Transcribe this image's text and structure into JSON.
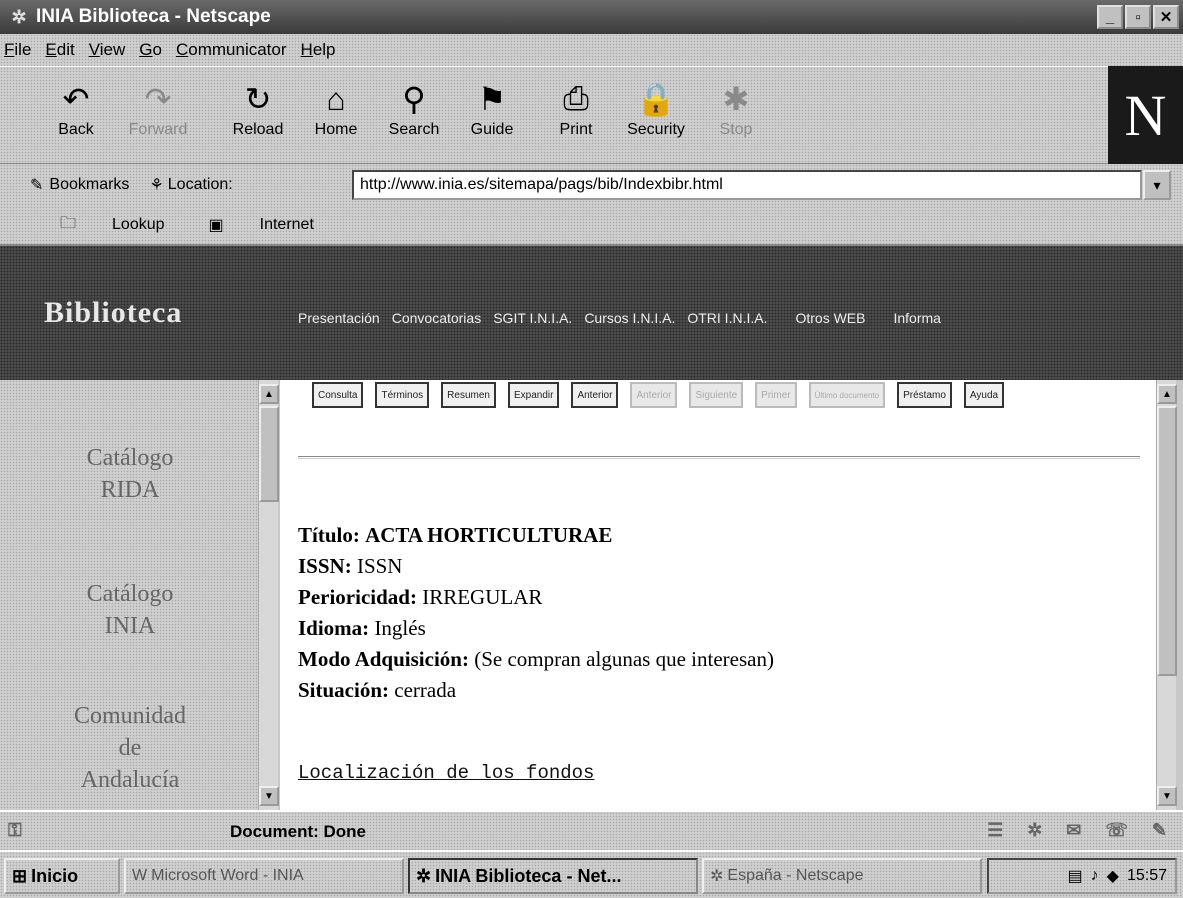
{
  "window": {
    "title": "INIA Biblioteca - Netscape",
    "minimize": "_",
    "maximize": "▫",
    "close": "✕"
  },
  "menu": [
    "File",
    "Edit",
    "View",
    "Go",
    "Communicator",
    "Help"
  ],
  "toolbar": {
    "back": "Back",
    "forward": "Forward",
    "reload": "Reload",
    "home": "Home",
    "search": "Search",
    "guide": "Guide",
    "print": "Print",
    "security": "Security",
    "stop": "Stop",
    "logo": "N"
  },
  "location": {
    "bookmarks": "Bookmarks",
    "label": "Location:",
    "url": "http://www.inia.es/sitemapa/pags/bib/Indexbibr.html"
  },
  "personal": {
    "lookup": "Lookup",
    "internet": "Internet"
  },
  "banner": {
    "title": "Biblioteca",
    "nav": [
      "Presentación",
      "Convocatorias",
      "SGIT I.N.I.A.",
      "Cursos I.N.I.A.",
      "OTRI I.N.I.A.",
      "Otros WEB",
      "Informa"
    ]
  },
  "left": {
    "items": [
      {
        "line1": "Catálogo",
        "line2": "RIDA"
      },
      {
        "line1": "Catálogo",
        "line2": "INIA"
      },
      {
        "line1": "Comunidad",
        "line2": "de",
        "line3": "Andalucía"
      }
    ]
  },
  "buttons": [
    {
      "label": "Consulta",
      "enabled": true
    },
    {
      "label": "Términos",
      "enabled": true
    },
    {
      "label": "Resumen",
      "enabled": true
    },
    {
      "label": "Expandir",
      "enabled": true
    },
    {
      "label": "Anterior",
      "enabled": true
    },
    {
      "label": "Anterior",
      "enabled": false
    },
    {
      "label": "Siguiente",
      "enabled": false
    },
    {
      "label": "Primer",
      "enabled": false
    },
    {
      "label": "Último documento",
      "enabled": false
    },
    {
      "label": "Préstamo",
      "enabled": true
    },
    {
      "label": "Ayuda",
      "enabled": true
    }
  ],
  "record": {
    "titulo_label": "Título:",
    "titulo": "ACTA HORTICULTURAE",
    "issn_label": "ISSN:",
    "issn": "ISSN",
    "periodicidad_label": "Perioricidad:",
    "periodicidad": "IRREGULAR",
    "idioma_label": "Idioma:",
    "idioma": "Inglés",
    "modo_label": "Modo Adquisición:",
    "modo": "(Se compran algunas que interesan)",
    "situacion_label": "Situación:",
    "situacion": "cerrada",
    "link": "Localización de los fondos"
  },
  "status": {
    "text": "Document: Done"
  },
  "taskbar": {
    "start": "Inicio",
    "tasks": [
      "Microsoft Word - INIA",
      "INIA Biblioteca - Net...",
      "España - Netscape"
    ],
    "clock": "15:57"
  }
}
